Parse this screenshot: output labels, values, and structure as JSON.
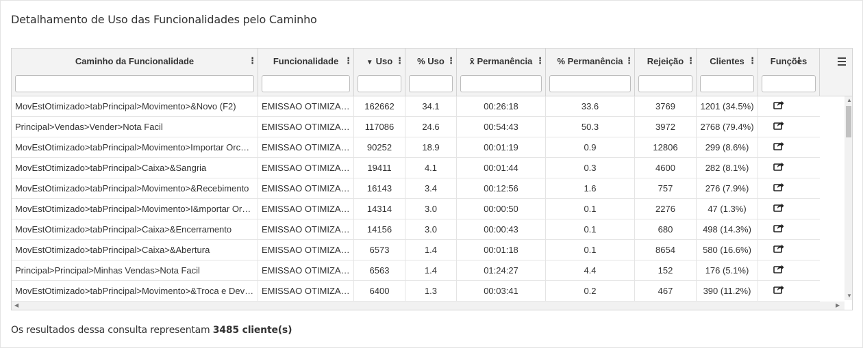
{
  "title": "Detalhamento de Uso das Funcionalidades pelo Caminho",
  "columns": [
    {
      "label": "Caminho da Funcionalidade"
    },
    {
      "label": "Funcionalidade"
    },
    {
      "label": "Uso",
      "sort": "desc"
    },
    {
      "label": "% Uso"
    },
    {
      "label": "x̄ Permanência"
    },
    {
      "label": "% Permanência"
    },
    {
      "label": "Rejeição"
    },
    {
      "label": "Clientes"
    },
    {
      "label": "Funções"
    }
  ],
  "rows": [
    [
      "MovEstOtimizado>tabPrincipal>Movimento>&Novo (F2)",
      "EMISSAO OTIMIZADA",
      "162662",
      "34.1",
      "00:26:18",
      "33.6",
      "3769",
      "1201 (34.5%)"
    ],
    [
      "Principal>Vendas>Vender>Nota Facil",
      "EMISSAO OTIMIZADA",
      "117086",
      "24.6",
      "00:54:43",
      "50.3",
      "3972",
      "2768 (79.4%)"
    ],
    [
      "MovEstOtimizado>tabPrincipal>Movimento>Importar Orcamento",
      "EMISSAO OTIMIZADA",
      "90252",
      "18.9",
      "00:01:19",
      "0.9",
      "12806",
      "299 (8.6%)"
    ],
    [
      "MovEstOtimizado>tabPrincipal>Caixa>&Sangria",
      "EMISSAO OTIMIZADA",
      "19411",
      "4.1",
      "00:01:44",
      "0.3",
      "4600",
      "282 (8.1%)"
    ],
    [
      "MovEstOtimizado>tabPrincipal>Movimento>&Recebimento",
      "EMISSAO OTIMIZADA",
      "16143",
      "3.4",
      "00:12:56",
      "1.6",
      "757",
      "276 (7.9%)"
    ],
    [
      "MovEstOtimizado>tabPrincipal>Movimento>I&mportar Orcamento",
      "EMISSAO OTIMIZADA",
      "14314",
      "3.0",
      "00:00:50",
      "0.1",
      "2276",
      "47 (1.3%)"
    ],
    [
      "MovEstOtimizado>tabPrincipal>Caixa>&Encerramento",
      "EMISSAO OTIMIZADA",
      "14156",
      "3.0",
      "00:00:43",
      "0.1",
      "680",
      "498 (14.3%)"
    ],
    [
      "MovEstOtimizado>tabPrincipal>Caixa>&Abertura",
      "EMISSAO OTIMIZADA",
      "6573",
      "1.4",
      "00:01:18",
      "0.1",
      "8654",
      "580 (16.6%)"
    ],
    [
      "Principal>Principal>Minhas Vendas>Nota Facil",
      "EMISSAO OTIMIZADA",
      "6563",
      "1.4",
      "01:24:27",
      "4.4",
      "152",
      "176 (5.1%)"
    ],
    [
      "MovEstOtimizado>tabPrincipal>Movimento>&Troca e Devolucao",
      "EMISSAO OTIMIZADA",
      "6400",
      "1.3",
      "00:03:41",
      "0.2",
      "467",
      "390 (11.2%)"
    ]
  ],
  "footer": {
    "text": "Os resultados dessa consulta representam",
    "count": "3485 cliente(s)"
  },
  "icons": {
    "row_action": "share-icon",
    "column_menu": "kebab-icon",
    "grid_menu": "hamburger-icon",
    "sort": "sort-desc-icon"
  }
}
